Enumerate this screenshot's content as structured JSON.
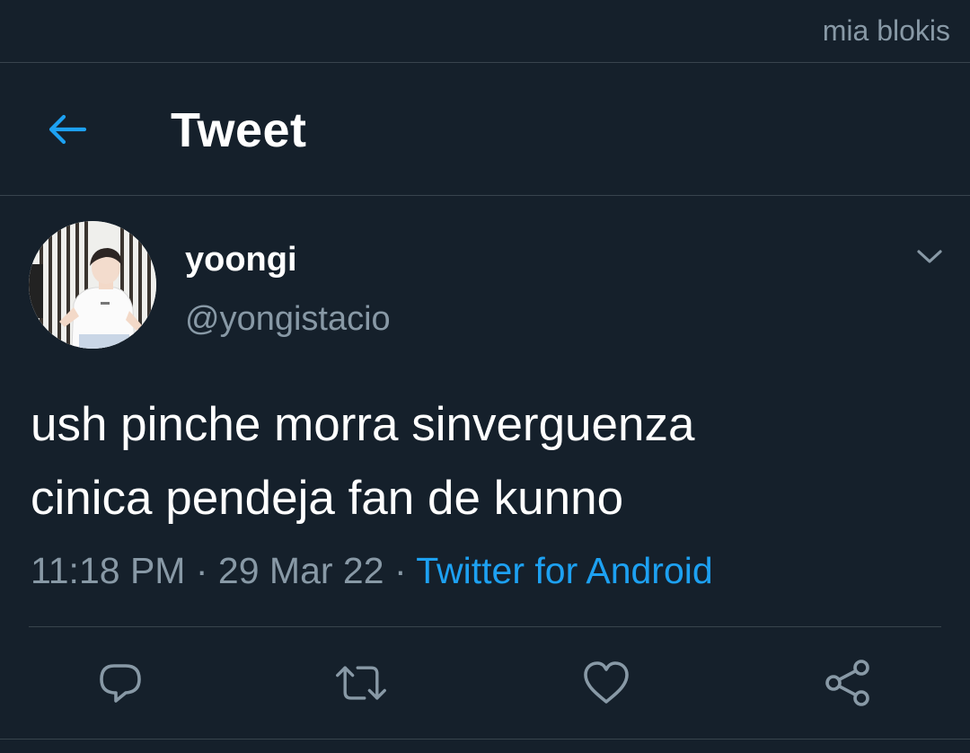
{
  "watermark": "mia blokis",
  "header": {
    "title": "Tweet",
    "back_icon": "arrow-left-icon"
  },
  "colors": {
    "background": "#15202b",
    "accent": "#1da1f2",
    "secondary_text": "#8899a6",
    "divider": "#38444d"
  },
  "tweet": {
    "display_name": "yoongi",
    "handle": "@yongistacio",
    "text_lines": [
      "ush pinche morra sinverguenza",
      "cinica pendeja fan de kunno"
    ],
    "time": "11:18 PM",
    "date": "29 Mar 22",
    "source": "Twitter for Android",
    "separator": "·"
  },
  "actions": [
    {
      "icon": "reply-icon"
    },
    {
      "icon": "retweet-icon"
    },
    {
      "icon": "like-icon"
    },
    {
      "icon": "share-icon"
    }
  ]
}
